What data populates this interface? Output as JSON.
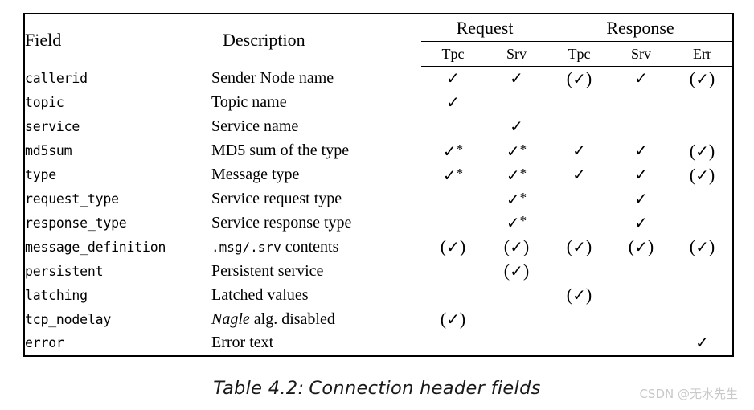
{
  "table": {
    "column_groups": [
      {
        "label": "",
        "span": 1
      },
      {
        "label": "",
        "span": 1
      },
      {
        "label": "Request",
        "span": 2
      },
      {
        "label": "Response",
        "span": 3
      }
    ],
    "headers": {
      "field": "Field",
      "description": "Description",
      "request": "Request",
      "response": "Response",
      "request_tpc": "Tpc",
      "request_srv": "Srv",
      "response_tpc": "Tpc",
      "response_srv": "Srv",
      "response_err": "Err"
    },
    "marks": {
      "check": "✓",
      "check_star": "✓*",
      "check_paren": "(✓)",
      "empty": ""
    },
    "rows": [
      {
        "field": "callerid",
        "description": "Sender Node name",
        "desc_style": "serif",
        "request_tpc": "check",
        "request_srv": "check",
        "response_tpc": "check_paren",
        "response_srv": "check",
        "response_err": "check_paren"
      },
      {
        "field": "topic",
        "description": "Topic name",
        "desc_style": "serif",
        "request_tpc": "check",
        "request_srv": "empty",
        "response_tpc": "empty",
        "response_srv": "empty",
        "response_err": "empty"
      },
      {
        "field": "service",
        "description": "Service name",
        "desc_style": "serif",
        "request_tpc": "empty",
        "request_srv": "check",
        "response_tpc": "empty",
        "response_srv": "empty",
        "response_err": "empty"
      },
      {
        "field": "md5sum",
        "description": "MD5 sum of the type",
        "desc_style": "serif",
        "request_tpc": "check_star",
        "request_srv": "check_star",
        "response_tpc": "check",
        "response_srv": "check",
        "response_err": "check_paren"
      },
      {
        "field": "type",
        "description": "Message type",
        "desc_style": "serif",
        "request_tpc": "check_star",
        "request_srv": "check_star",
        "response_tpc": "check",
        "response_srv": "check",
        "response_err": "check_paren"
      },
      {
        "field": "request_type",
        "description": "Service request type",
        "desc_style": "serif",
        "request_tpc": "empty",
        "request_srv": "check_star",
        "response_tpc": "empty",
        "response_srv": "check",
        "response_err": "empty"
      },
      {
        "field": "response_type",
        "description": "Service response type",
        "desc_style": "serif",
        "request_tpc": "empty",
        "request_srv": "check_star",
        "response_tpc": "empty",
        "response_srv": "check",
        "response_err": "empty"
      },
      {
        "field": "message_definition",
        "description": ".msg/.srv contents",
        "desc_style": "mono-mixed",
        "desc_mono_a": ".msg/",
        "desc_mono_b": ".srv",
        "desc_tail": " contents",
        "request_tpc": "check_paren",
        "request_srv": "check_paren",
        "response_tpc": "check_paren",
        "response_srv": "check_paren",
        "response_err": "check_paren"
      },
      {
        "field": "persistent",
        "description": "Persistent service",
        "desc_style": "serif",
        "request_tpc": "empty",
        "request_srv": "check_paren",
        "response_tpc": "empty",
        "response_srv": "empty",
        "response_err": "empty"
      },
      {
        "field": "latching",
        "description": "Latched values",
        "desc_style": "serif",
        "request_tpc": "empty",
        "request_srv": "empty",
        "response_tpc": "check_paren",
        "response_srv": "empty",
        "response_err": "empty"
      },
      {
        "field": "tcp_nodelay",
        "description": "Nagle alg. disabled",
        "desc_style": "italic-lead",
        "desc_italic": "Nagle",
        "desc_tail": " alg. disabled",
        "request_tpc": "check_paren",
        "request_srv": "empty",
        "response_tpc": "empty",
        "response_srv": "empty",
        "response_err": "empty"
      },
      {
        "field": "error",
        "description": "Error text",
        "desc_style": "serif",
        "request_tpc": "empty",
        "request_srv": "empty",
        "response_tpc": "empty",
        "response_srv": "empty",
        "response_err": "check"
      }
    ]
  },
  "caption": {
    "number": "Table 4.2:",
    "text": "Connection header fields",
    "full": "Table 4.2:  Connection header fields"
  },
  "watermark": {
    "text": "CSDN @无水先生"
  },
  "colors": {
    "text": "#000000",
    "rule": "#000000",
    "watermark": "#c9c9c9",
    "background": "#ffffff"
  }
}
